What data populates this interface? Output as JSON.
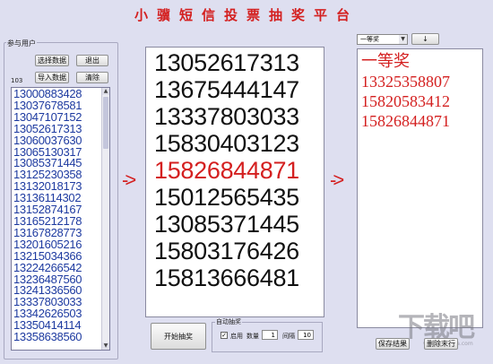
{
  "title": "小骥短信投票抽奖平台",
  "participants": {
    "group_label": "参与用户",
    "select_data_label": "选择数据",
    "exit_label": "退出",
    "import_data_label": "导入数据",
    "clear_label": "清除",
    "count": "103",
    "numbers": [
      "13000883428",
      "13037678581",
      "13047107152",
      "13052617313",
      "13060037630",
      "13065130317",
      "13085371445",
      "13125230358",
      "13132018173",
      "13136114302",
      "13152874167",
      "13165212178",
      "13167828773",
      "13201605216",
      "13215034366",
      "13224266542",
      "13236487560",
      "13241336560",
      "13337803033",
      "13342626503",
      "13350414114",
      "13358638560"
    ]
  },
  "arrows": {
    "left": "->",
    "right": "->"
  },
  "draw": {
    "numbers": [
      "13052617313",
      "13675444147",
      "13337803033",
      "15830403123",
      "15826844871",
      "15012565435",
      "13085371445",
      "15803176426",
      "15813666481"
    ],
    "highlight_index": 4,
    "highlight_color": "#d42020",
    "start_label": "开始抽奖"
  },
  "auto": {
    "group_label": "自动抽奖",
    "enable_label": "启用",
    "enabled": true,
    "quantity_label": "数量",
    "quantity": "1",
    "interval_label": "间隔",
    "interval": "10"
  },
  "prize": {
    "select_value": "一等奖",
    "down_label": "↓",
    "heading": "一等奖",
    "winners": [
      "13325358807",
      "15820583412",
      "15826844871"
    ],
    "save_label": "保存结果",
    "delete_label": "删除末行"
  },
  "watermark": {
    "main": "下载吧",
    "sub": "www.xiazaiba.com"
  },
  "colors": {
    "accent": "#d42020",
    "list_text": "#1d3aa0",
    "background": "#dedff0"
  }
}
